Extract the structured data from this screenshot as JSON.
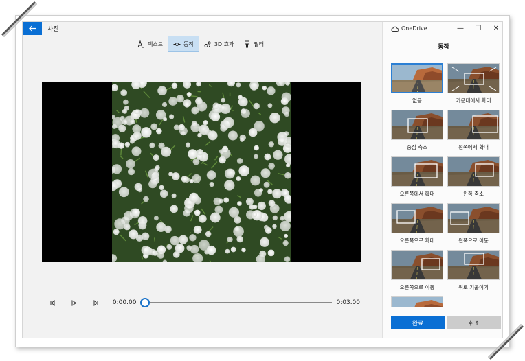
{
  "app": {
    "title": "사진",
    "back_icon": "back-arrow-icon",
    "accent": "#0a6fd4"
  },
  "toolbar": {
    "items": [
      {
        "label": "텍스트",
        "icon": "text-icon"
      },
      {
        "label": "동작",
        "icon": "motion-icon"
      },
      {
        "label": "3D 효과",
        "icon": "3d-effects-icon"
      },
      {
        "label": "필터",
        "icon": "filter-icon"
      }
    ],
    "active_index": 1
  },
  "playback": {
    "current_time": "0:00.00",
    "total_time": "0:03.00",
    "progress": 0
  },
  "panel": {
    "account": "OneDrive",
    "heading": "동작",
    "motions": [
      "없음",
      "가운데에서 확대",
      "중심 축소",
      "왼쪽에서 확대",
      "오른쪽에서 확대",
      "왼쪽 축소",
      "오른쪽으로 확대",
      "왼쪽으로 이동",
      "오른쪽으로 이동",
      "위로 기울이기",
      ""
    ],
    "selected_index": 0,
    "done_label": "완료",
    "cancel_label": "취소"
  },
  "window_controls": {
    "minimize": "—",
    "maximize": "☐",
    "close": "✕"
  }
}
